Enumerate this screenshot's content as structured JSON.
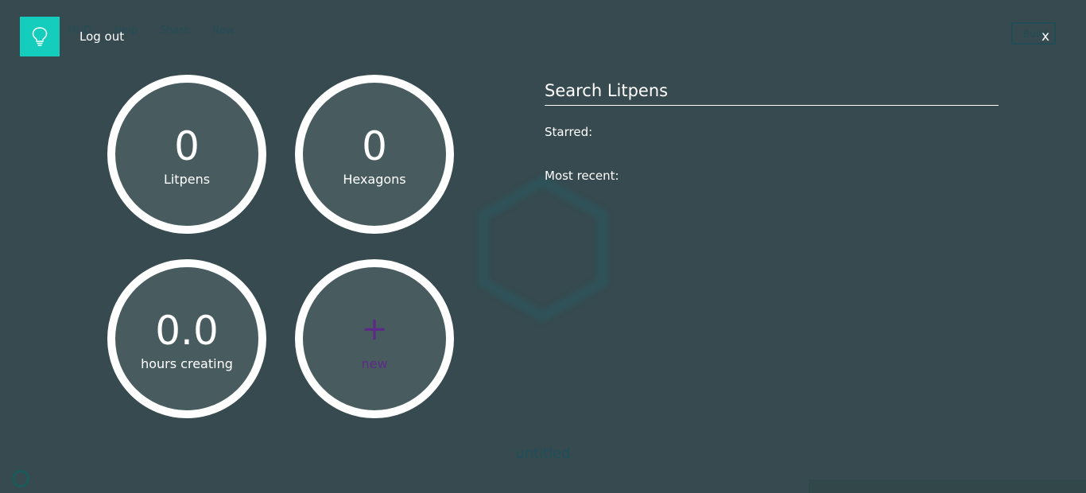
{
  "background": {
    "nav_items": [
      "HUD",
      "Help",
      "Share",
      "New"
    ],
    "build_label": "Build",
    "document_title": "untitled"
  },
  "header": {
    "logout_label": "Log out",
    "close_label": "x",
    "logo_icon": "lightbulb-icon"
  },
  "stats": {
    "litpens": {
      "value": "0",
      "label": "Litpens"
    },
    "hexagons": {
      "value": "0",
      "label": "Hexagons"
    },
    "hours": {
      "value": "0.0",
      "label": "hours creating"
    },
    "new": {
      "icon": "+",
      "label": "new"
    }
  },
  "search": {
    "placeholder": "Search Litpens",
    "starred_label": "Starred:",
    "recent_label": "Most recent:"
  },
  "colors": {
    "background": "#364a4f",
    "logo": "#14cdbd",
    "circle_fill": "#485c5f",
    "new_accent": "#5c2b86"
  }
}
